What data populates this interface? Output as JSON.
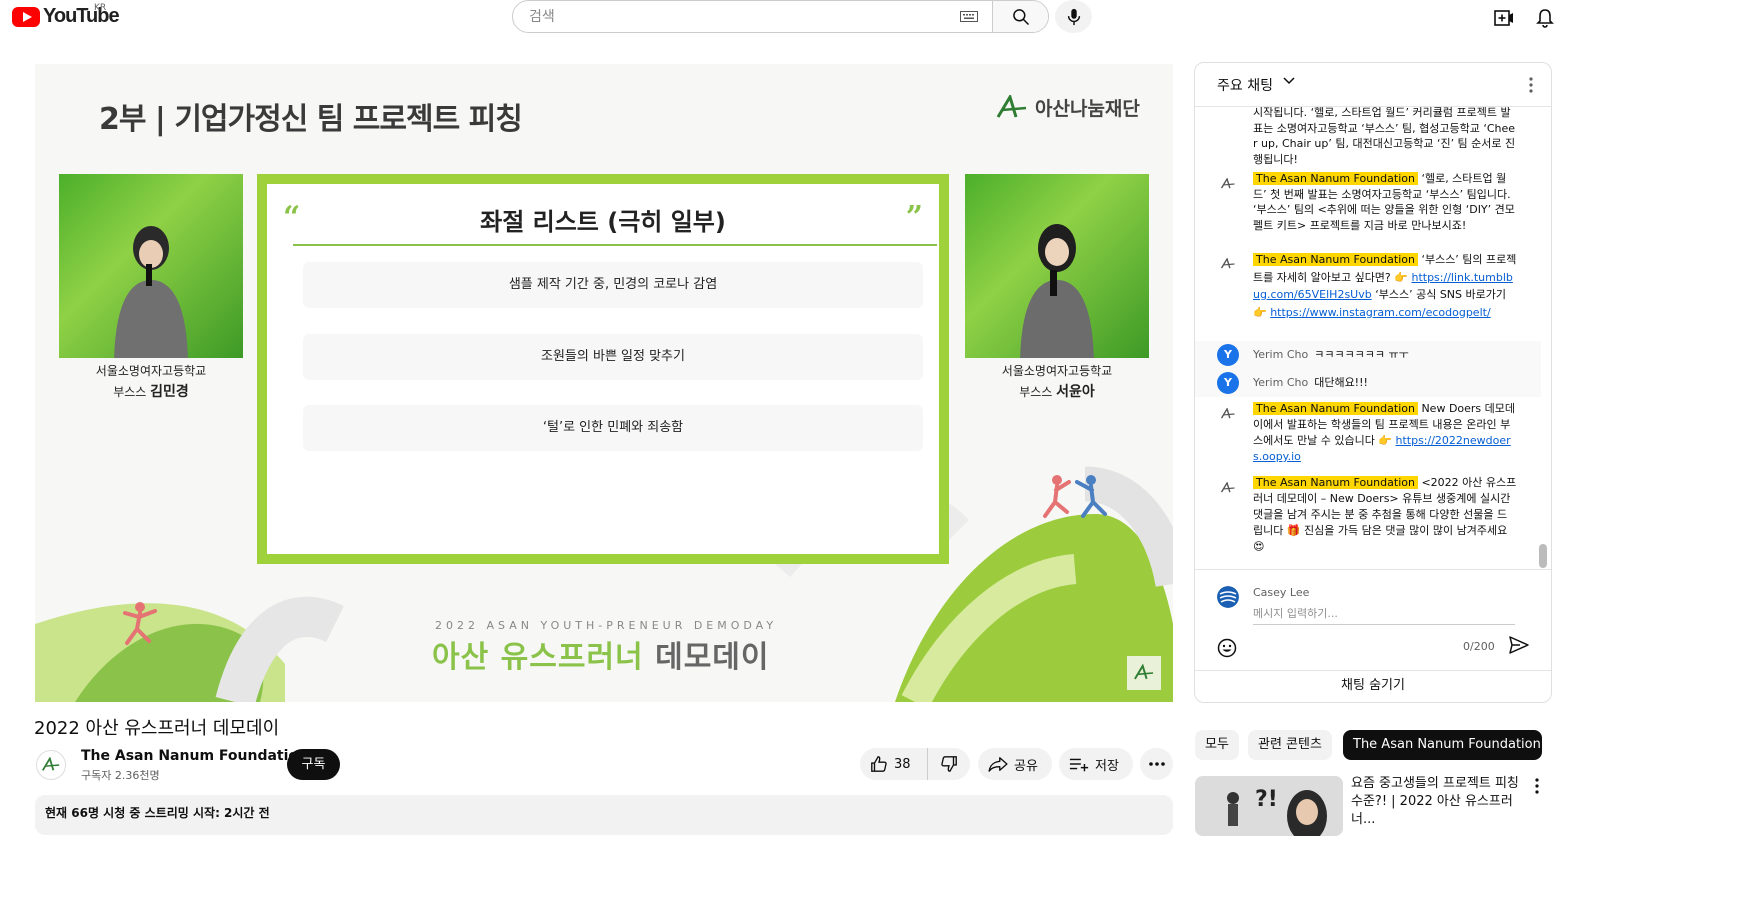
{
  "header": {
    "logo_text": "YouTube",
    "region": "KR",
    "search_placeholder": "검색",
    "icons": [
      "keyboard-icon",
      "search-icon",
      "mic-icon",
      "create-icon",
      "bell-icon"
    ]
  },
  "player": {
    "slide_heading": "2부 | 기업가정신 팀 프로젝트 피칭",
    "brand_text": "아산나눔재단",
    "left_speaker": {
      "school": "서울소명여자고등학교",
      "role": "부스스",
      "name": "김민경"
    },
    "right_speaker": {
      "school": "서울소명여자고등학교",
      "role": "부스스",
      "name": "서윤아"
    },
    "slide_title": "좌절 리스트 (극히 일부)",
    "slide_items": [
      "샘플 제작 기간 중, 민경의 코로나 감염",
      "조원들의 바쁜 일정 맞추기",
      "‘털’로 인한 민폐와 죄송함"
    ],
    "event_en": "2022 ASAN YOUTH-PRENEUR DEMODAY",
    "event_ko_green": "아산 유스프러너",
    "event_ko_grey": " 데모데이"
  },
  "video": {
    "title": "2022 아산 유스프러너 데모데이",
    "channel_name": "The Asan Nanum Foundation",
    "subscribers": "구독자 2.36천명",
    "subscribe_label": "구독",
    "like_count": "38",
    "share_label": "공유",
    "save_label": "저장",
    "description_line": "현재 66명 시청 중  스트리밍 시작: 2시간 전"
  },
  "chat": {
    "header_title": "주요 채팅",
    "messages": [
      {
        "type": "cont",
        "text": "시작됩니다. ‘헬로, 스타트업 월드’ 커리큘럼 프로젝트 발표는 소명여자고등학교 ‘부스스’ 팀, 협성고등학교 ‘Cheer up, Chair up’ 팀, 대전대신고등학교 ‘진’ 팀 순서로 진행됩니다!"
      },
      {
        "type": "owner",
        "author": "The Asan Nanum Foundation",
        "text": "‘헬로, 스타트업 월드’ 첫 번째 발표는 소명여자고등학교 ‘부스스’ 팀입니다. ‘부스스’ 팀의 <추위에 떠는 양들을 위한 인형 ‘DIY’ 견모펠트 키트> 프로젝트를 지금 바로 만나보시죠!"
      },
      {
        "type": "owner",
        "author": "The Asan Nanum Foundation",
        "text": "‘부스스’ 팀의 프로젝트를 자세히 알아보고 싶다면? 👉 ",
        "link1": "https://link.tumblbug.com/65VElH2sUvb",
        "text2": " ‘부스스’ 공식 SNS 바로가기 👉 ",
        "link2": "https://www.instagram.com/ecodogpelt/"
      },
      {
        "type": "user",
        "author": "Yerim Cho",
        "initial": "Y",
        "text": "ㅋㅋㅋㅋㅋㅋㅋ ㅠㅜ"
      },
      {
        "type": "user",
        "author": "Yerim Cho",
        "initial": "Y",
        "text": "대단해요!!!"
      },
      {
        "type": "owner",
        "author": "The Asan Nanum Foundation",
        "text": "New Doers 데모데이에서 발표하는 학생들의 팀 프로젝트 내용은 온라인 부스에서도 만날 수 있습니다 👉 ",
        "link1": "https://2022newdoers.oopy.io"
      },
      {
        "type": "owner",
        "author": "The Asan Nanum Foundation",
        "text": "<2022 아산 유스프러너 데모데이 – New Doers> 유튜브 생중계에 실시간 댓글을 남겨 주시는 분 중 추첨을 통해 다양한 선물을 드립니다 🎁 진심을 가득 담은 댓글 많이 많이 남겨주세요 😍"
      }
    ],
    "input_user": "Casey Lee",
    "input_placeholder": "메시지 입력하기...",
    "char_count": "0/200",
    "hide_label": "채팅 숨기기"
  },
  "related": {
    "chips": [
      "모두",
      "관련 콘텐츠",
      "The Asan Nanum Foundation ..."
    ],
    "active_chip": 2,
    "video_title": "요즘 중고생들의 프로젝트 피칭 수준?! | 2022 아산 유스프러너..."
  }
}
